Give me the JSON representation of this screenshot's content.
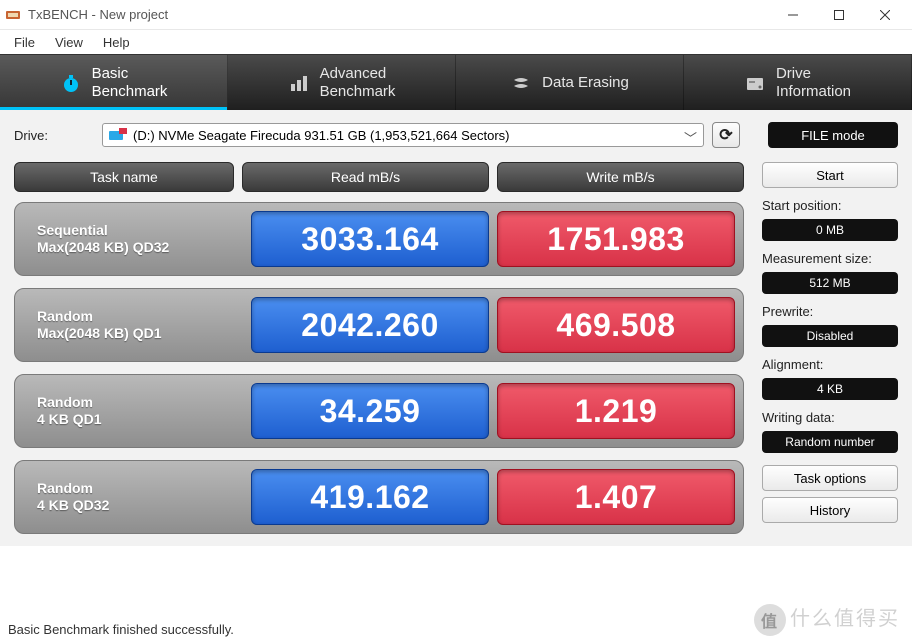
{
  "window": {
    "title": "TxBENCH - New project"
  },
  "menu": {
    "file": "File",
    "view": "View",
    "help": "Help"
  },
  "tabs": {
    "basic": "Basic\nBenchmark",
    "advanced": "Advanced\nBenchmark",
    "erasing": "Data Erasing",
    "driveinfo": "Drive\nInformation"
  },
  "drive": {
    "label": "Drive:",
    "selected": "(D:) NVMe Seagate Firecuda  931.51 GB (1,953,521,664 Sectors)",
    "refresh_icon": "⟳",
    "file_mode": "FILE mode"
  },
  "headers": {
    "task": "Task name",
    "read": "Read mB/s",
    "write": "Write mB/s"
  },
  "chart_data": {
    "type": "table",
    "title": "Basic Benchmark",
    "columns": [
      "Task name",
      "Read mB/s",
      "Write mB/s"
    ],
    "rows": [
      {
        "task_l1": "Sequential",
        "task_l2": "Max(2048 KB) QD32",
        "read": "3033.164",
        "write": "1751.983"
      },
      {
        "task_l1": "Random",
        "task_l2": "Max(2048 KB) QD1",
        "read": "2042.260",
        "write": "469.508"
      },
      {
        "task_l1": "Random",
        "task_l2": "4 KB QD1",
        "read": "34.259",
        "write": "1.219"
      },
      {
        "task_l1": "Random",
        "task_l2": "4 KB QD32",
        "read": "419.162",
        "write": "1.407"
      }
    ]
  },
  "sidebar": {
    "start": "Start",
    "start_pos_label": "Start position:",
    "start_pos_val": "0 MB",
    "meas_size_label": "Measurement size:",
    "meas_size_val": "512 MB",
    "prewrite_label": "Prewrite:",
    "prewrite_val": "Disabled",
    "alignment_label": "Alignment:",
    "alignment_val": "4 KB",
    "writing_data_label": "Writing data:",
    "writing_data_val": "Random number",
    "task_options": "Task options",
    "history": "History"
  },
  "status": "Basic Benchmark finished successfully.",
  "watermark": {
    "logo": "值",
    "text": "什么值得买"
  }
}
